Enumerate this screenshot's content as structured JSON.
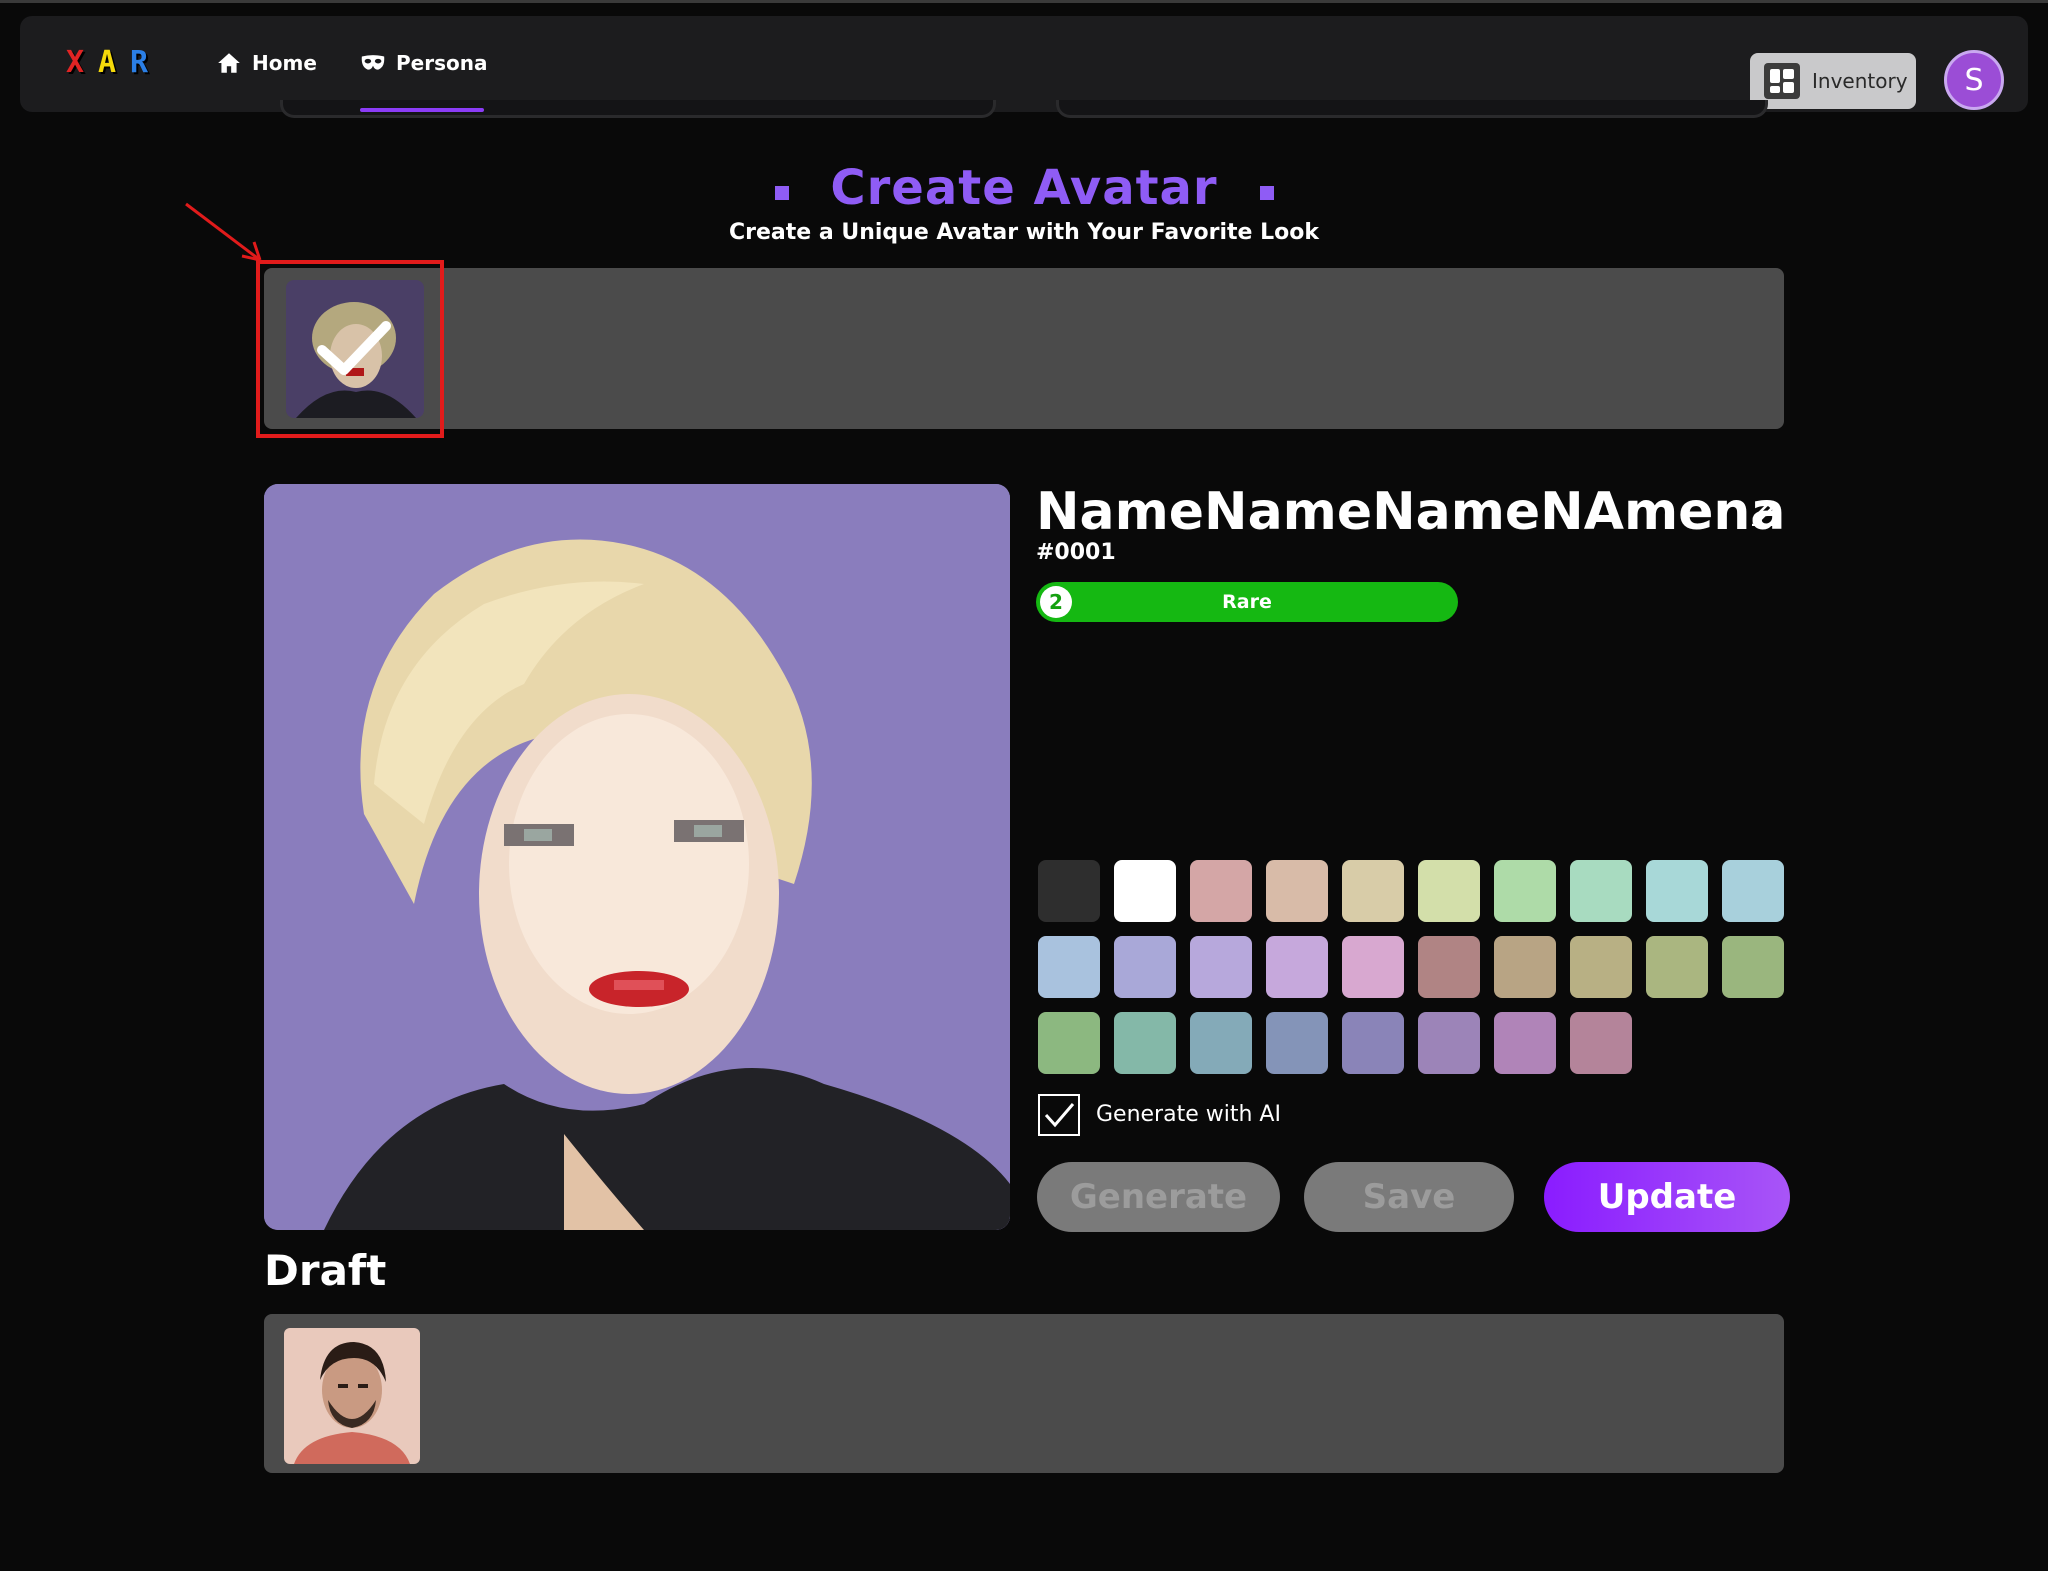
{
  "header": {
    "logo_letters": [
      "X",
      "A",
      "R"
    ],
    "logo_colors": [
      "#e02424",
      "#f5d90a",
      "#2b7fe6"
    ],
    "nav": [
      {
        "label": "Home",
        "icon": "home-icon"
      },
      {
        "label": "Persona",
        "icon": "mask-icon",
        "active": true
      }
    ],
    "inventory_label": "Inventory",
    "user_initial": "S"
  },
  "page": {
    "title": "Create Avatar",
    "subtitle": "Create a Unique Avatar with Your Favorite Look"
  },
  "avatar": {
    "name": "NameNameNameNAmena",
    "id": "#0001",
    "rarity_level": "2",
    "rarity_label": "Rare",
    "selected_thumbnail": "pixel-portrait-blonde",
    "main_background": "#8a7dbd"
  },
  "palette": [
    "#2e2e2e",
    "#ffffff",
    "#d4a6a6",
    "#d8bba8",
    "#d8cca8",
    "#d3dfaa",
    "#aedba8",
    "#a8dbc0",
    "#a8d8d8",
    "#a8d0dc",
    "#a9c2de",
    "#a9a8d8",
    "#b7a8dc",
    "#c6a8dc",
    "#d8a8d0",
    "#b08484",
    "#b8a484",
    "#b8b084",
    "#aab680",
    "#9ab67e",
    "#8cb880",
    "#84b8a8",
    "#84aab8",
    "#8494b8",
    "#8a84b8",
    "#9c84b8",
    "#b084b8",
    "#b4849a"
  ],
  "controls": {
    "generate_with_ai_label": "Generate with AI",
    "generate_with_ai_checked": true,
    "generate_label": "Generate",
    "save_label": "Save",
    "update_label": "Update"
  },
  "draft": {
    "title": "Draft",
    "items": [
      "photo-portrait-man"
    ]
  }
}
